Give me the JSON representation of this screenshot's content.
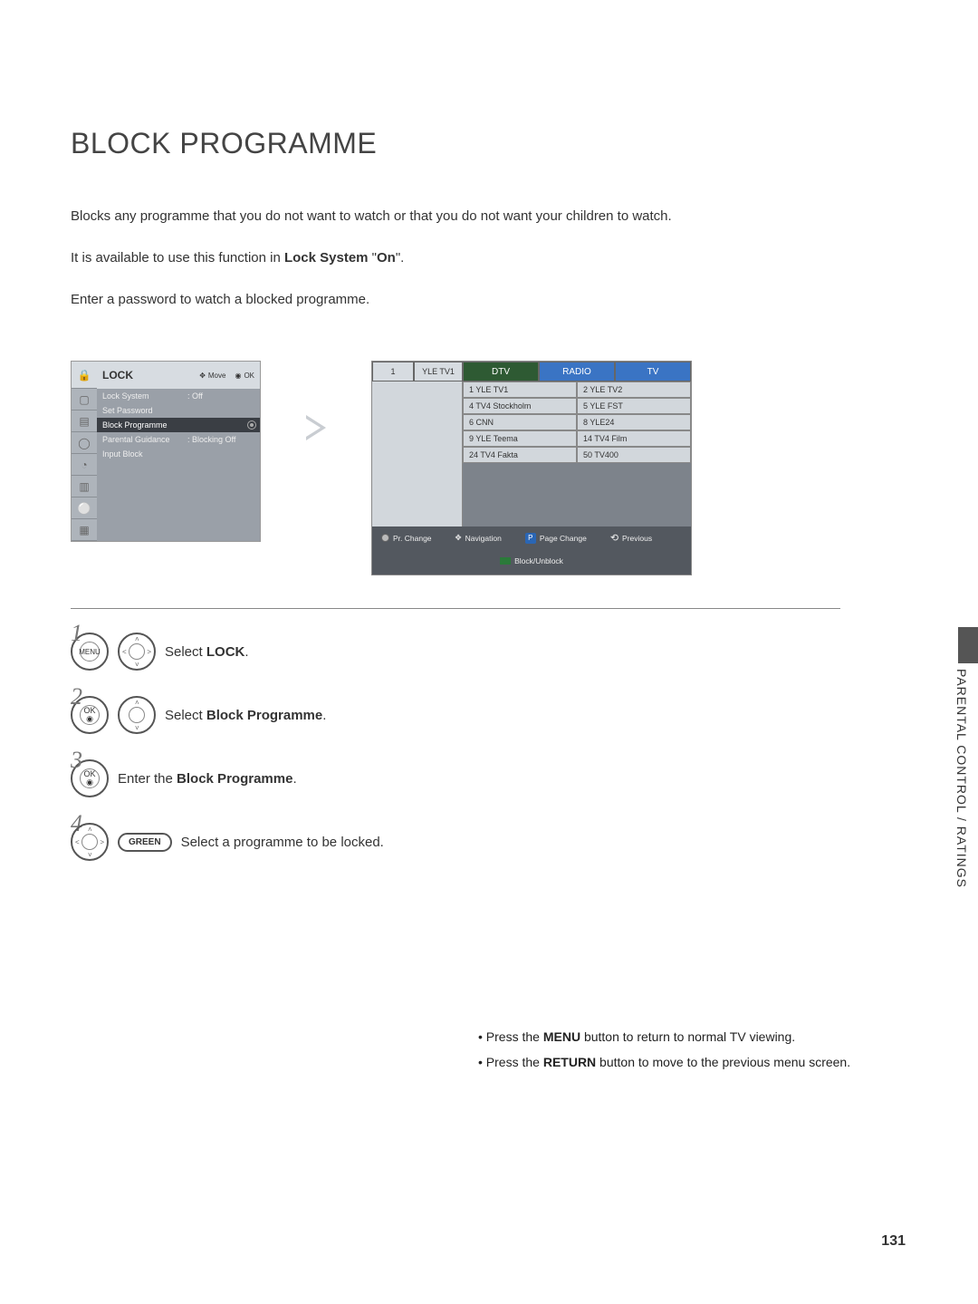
{
  "title": "BLOCK PROGRAMME",
  "intro": {
    "p1": "Blocks any programme that you do not want to watch or that you do not want your children to watch.",
    "p2_a": "It is available to use this function in ",
    "p2_b": "Lock System",
    "p2_c": " \"",
    "p2_d": "On",
    "p2_e": "\".",
    "p3": "Enter a password to watch a blocked programme."
  },
  "lock_menu": {
    "title": "LOCK",
    "hint_move": "Move",
    "hint_ok": "OK",
    "rows": [
      {
        "k": "Lock System",
        "v": ": Off"
      },
      {
        "k": "Set Password",
        "v": ""
      },
      {
        "k": "Block Programme",
        "v": ""
      },
      {
        "k": "Parental Guidance",
        "v": ": Blocking Off"
      },
      {
        "k": "Input Block",
        "v": ""
      }
    ]
  },
  "ch": {
    "num": "1",
    "name": "YLE TV1",
    "tabs": {
      "dtv": "DTV",
      "radio": "RADIO",
      "tv": "TV"
    },
    "col1": [
      "1 YLE TV1",
      "4 TV4 Stockholm",
      "6 CNN",
      "9 YLE Teema",
      "24 TV4 Fakta"
    ],
    "col2": [
      "2 YLE TV2",
      "5 YLE FST",
      "8 YLE24",
      "14 TV4 Film",
      "50 TV400"
    ],
    "foot": {
      "change": "Pr. Change",
      "nav": "Navigation",
      "page": "Page Change",
      "prev": "Previous",
      "block": "Block/Unblock",
      "p": "P"
    }
  },
  "steps": {
    "s1": {
      "btn": "MENU",
      "txt_a": "Select ",
      "txt_b": "LOCK",
      "txt_c": "."
    },
    "s2": {
      "btn": "OK",
      "txt_a": "Select ",
      "txt_b": "Block Programme",
      "txt_c": "."
    },
    "s3": {
      "btn": "OK",
      "txt_a": "Enter the ",
      "txt_b": "Block Programme",
      "txt_c": "."
    },
    "s4": {
      "btn": "GREEN",
      "txt": "Select a programme to be locked."
    }
  },
  "notes": {
    "n1_a": "Press the ",
    "n1_b": "MENU",
    "n1_c": " button to return to normal TV viewing.",
    "n2_a": "Press the ",
    "n2_b": "RETURN",
    "n2_c": " button to move to the previous menu screen."
  },
  "side_tab": "PARENTAL CONTROL / RATINGS",
  "page_num": "131"
}
